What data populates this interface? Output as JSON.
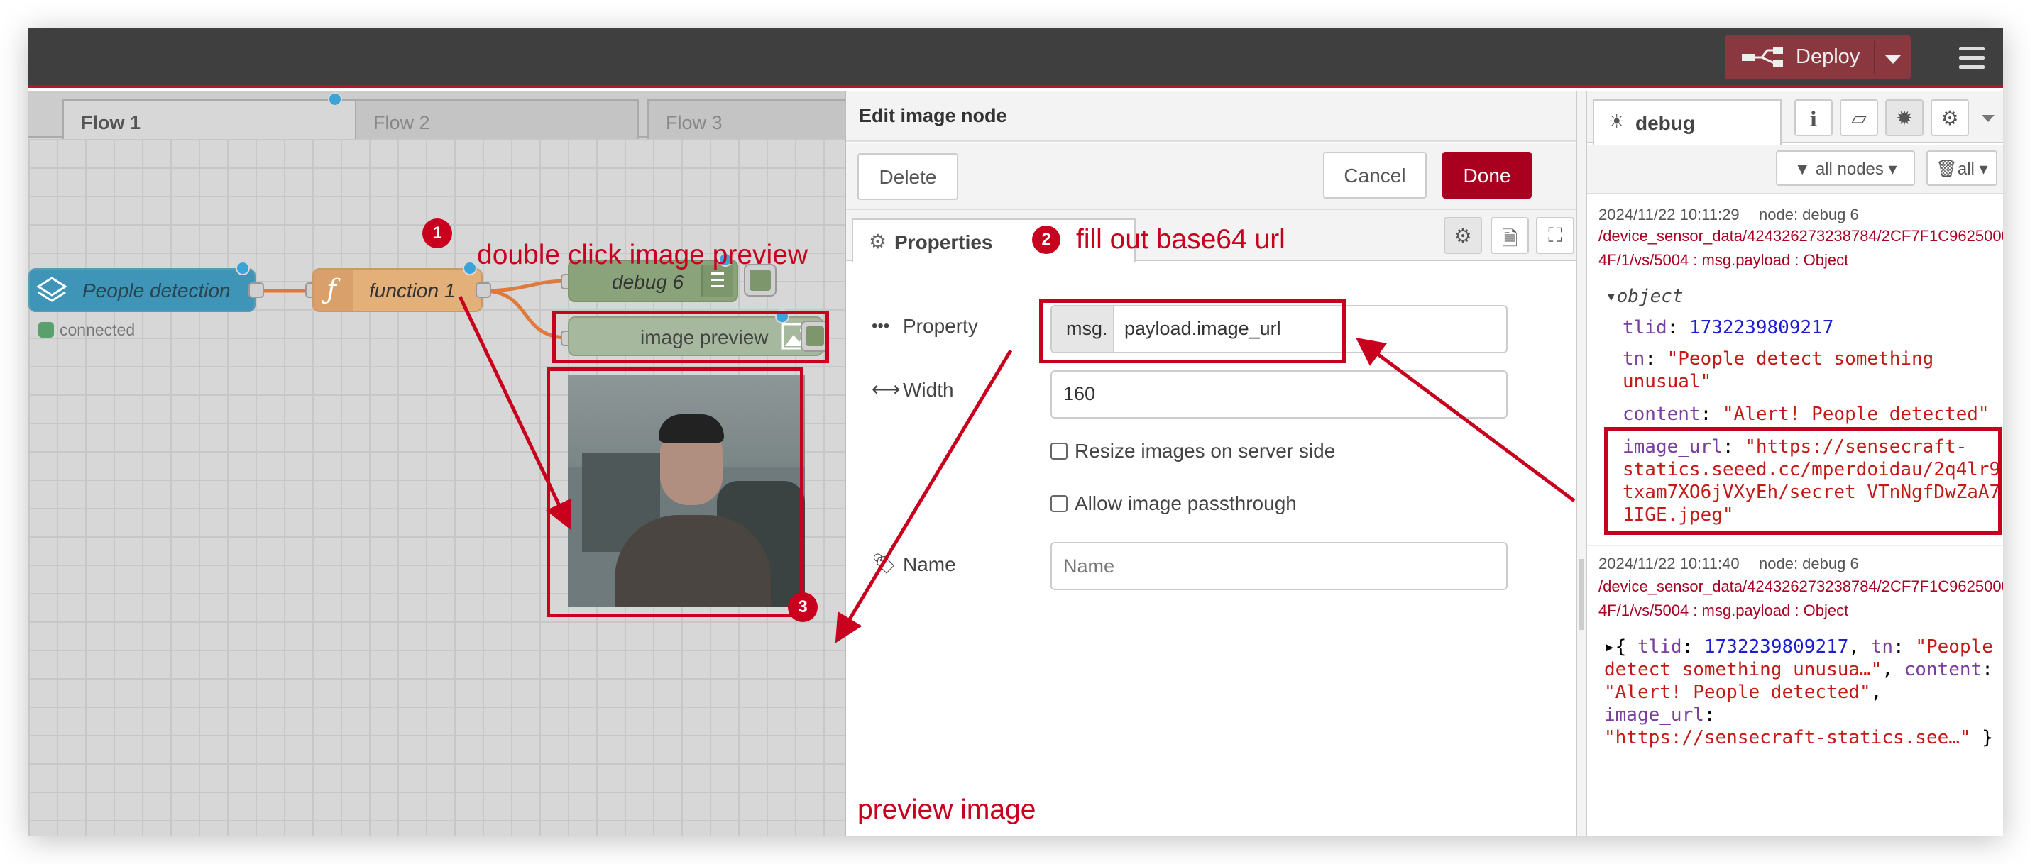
{
  "header": {
    "deploy_label": "Deploy"
  },
  "workspace": {
    "tabs": [
      {
        "label": "Flow 1"
      },
      {
        "label": "Flow 2"
      },
      {
        "label": "Flow 3"
      }
    ],
    "nodes": {
      "people_detection": "People detection",
      "connected": "connected",
      "function_1": "function 1",
      "debug_6": "debug 6",
      "image_preview": "image preview"
    }
  },
  "annotations": {
    "step1_num": "1",
    "step1": "double click image preview",
    "step2_num": "2",
    "step2": "fill out base64 url",
    "step3_num": "3",
    "step3": "preview image"
  },
  "editor": {
    "title": "Edit image node",
    "delete_label": "Delete",
    "cancel_label": "Cancel",
    "done_label": "Done",
    "tab_properties": "Properties",
    "property_label": "Property",
    "property_prefix": "msg.",
    "property_value": "payload.image_url",
    "width_label": "Width",
    "width_value": "160",
    "resize_label": "Resize images on server side",
    "passthrough_label": "Allow image passthrough",
    "name_label": "Name",
    "name_placeholder": "Name"
  },
  "sidebar": {
    "tab_label": "debug",
    "filter_label": "all nodes",
    "clear_label": "all",
    "messages": [
      {
        "timestamp": "2024/11/22 10:11:29",
        "node": "node: debug 6",
        "topic_line1": "/device_sensor_data/424326273238784/2CF7F1C9625000",
        "topic_line2": "4F/1/vs/5004 : msg.payload : Object",
        "object_label": "object",
        "tlid_key": "tlid",
        "tlid_val": "1732239809217",
        "tn_key": "tn",
        "tn_val_1": "\"People detect something",
        "tn_val_2": "unusual\"",
        "content_key": "content",
        "content_val": "\"Alert! People detected\"",
        "url_key": "image_url",
        "url_val_1": "\"https://sensecraft-",
        "url_val_2": "statics.seeed.cc/mperdoidau/2q4lr9",
        "url_val_3": "txam7XO6jVXyEh/secret_VTnNgfDwZaA7",
        "url_val_4": "1IGE.jpeg\""
      },
      {
        "timestamp": "2024/11/22 10:11:40",
        "node": "node: debug 6",
        "topic_line1": "/device_sensor_data/424326273238784/2CF7F1C9625000",
        "topic_line2": "4F/1/vs/5004 : msg.payload : Object",
        "collapsed": {
          "tlid_key": "tlid",
          "tlid_val": "1732239809217",
          "tn_key": "tn",
          "tn_val_1": "\"People",
          "tn_val_2": "detect something unusua…\"",
          "content_key": "content",
          "content_val": "\"Alert! People detected\"",
          "url_key": "image_url",
          "url_val": "\"https://sensecraft-statics.see…\""
        }
      }
    ]
  }
}
